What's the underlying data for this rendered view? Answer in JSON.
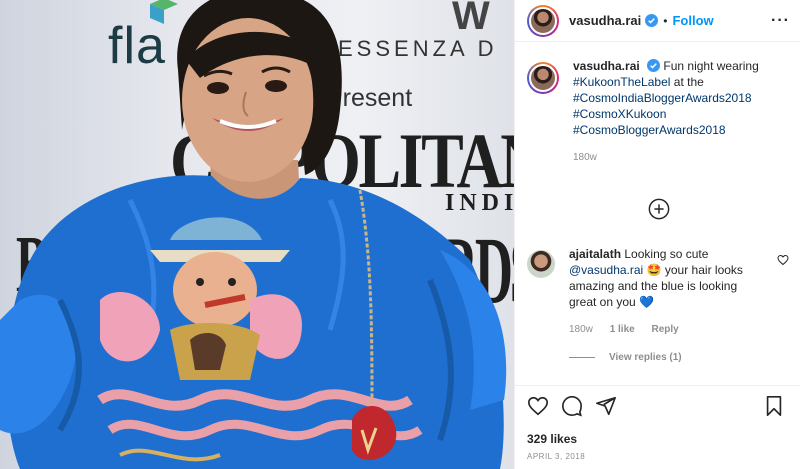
{
  "post": {
    "username": "vasudha.rai",
    "separator": "•",
    "follow_label": "Follow",
    "more_label": "···",
    "caption": {
      "username": "vasudha.rai",
      "text": "Fun night wearing",
      "tags": [
        "#KukoonTheLabel",
        "#CosmoIndiaBloggerAwards2018",
        "#CosmoXKukoon",
        "#CosmoBloggerAwards2018"
      ],
      "connector": "at the",
      "age": "180w"
    },
    "comment": {
      "username": "ajaitalath",
      "text_start": "Looking so cute",
      "mention": "@vasudha.rai",
      "emoji": "🤩",
      "text_end": "your hair looks amazing and the blue is looking great on you",
      "end_emoji": "💙",
      "age": "180w",
      "likes": "1 like",
      "reply_label": "Reply",
      "view_replies": "View replies (1)"
    },
    "likes_count": "329 likes",
    "date": "APRIL 3, 2018"
  },
  "backdrop": {
    "flaw": "fla",
    "essenza": "ESSENZA D",
    "present": "Present",
    "cosmo": "C  OPOLITAN",
    "india": "INDIA",
    "awards": "RDS",
    "b": "B",
    "w": "W"
  },
  "colors": {
    "accent": "#0095f6",
    "verified": "#3897f0",
    "dress": "#1f6fd1",
    "text": "#262626",
    "muted": "#8e8e8e"
  },
  "icons": [
    "verified-badge-icon",
    "more-options-icon",
    "add-comment-icon",
    "heart-icon",
    "comment-icon",
    "share-icon",
    "bookmark-icon"
  ]
}
